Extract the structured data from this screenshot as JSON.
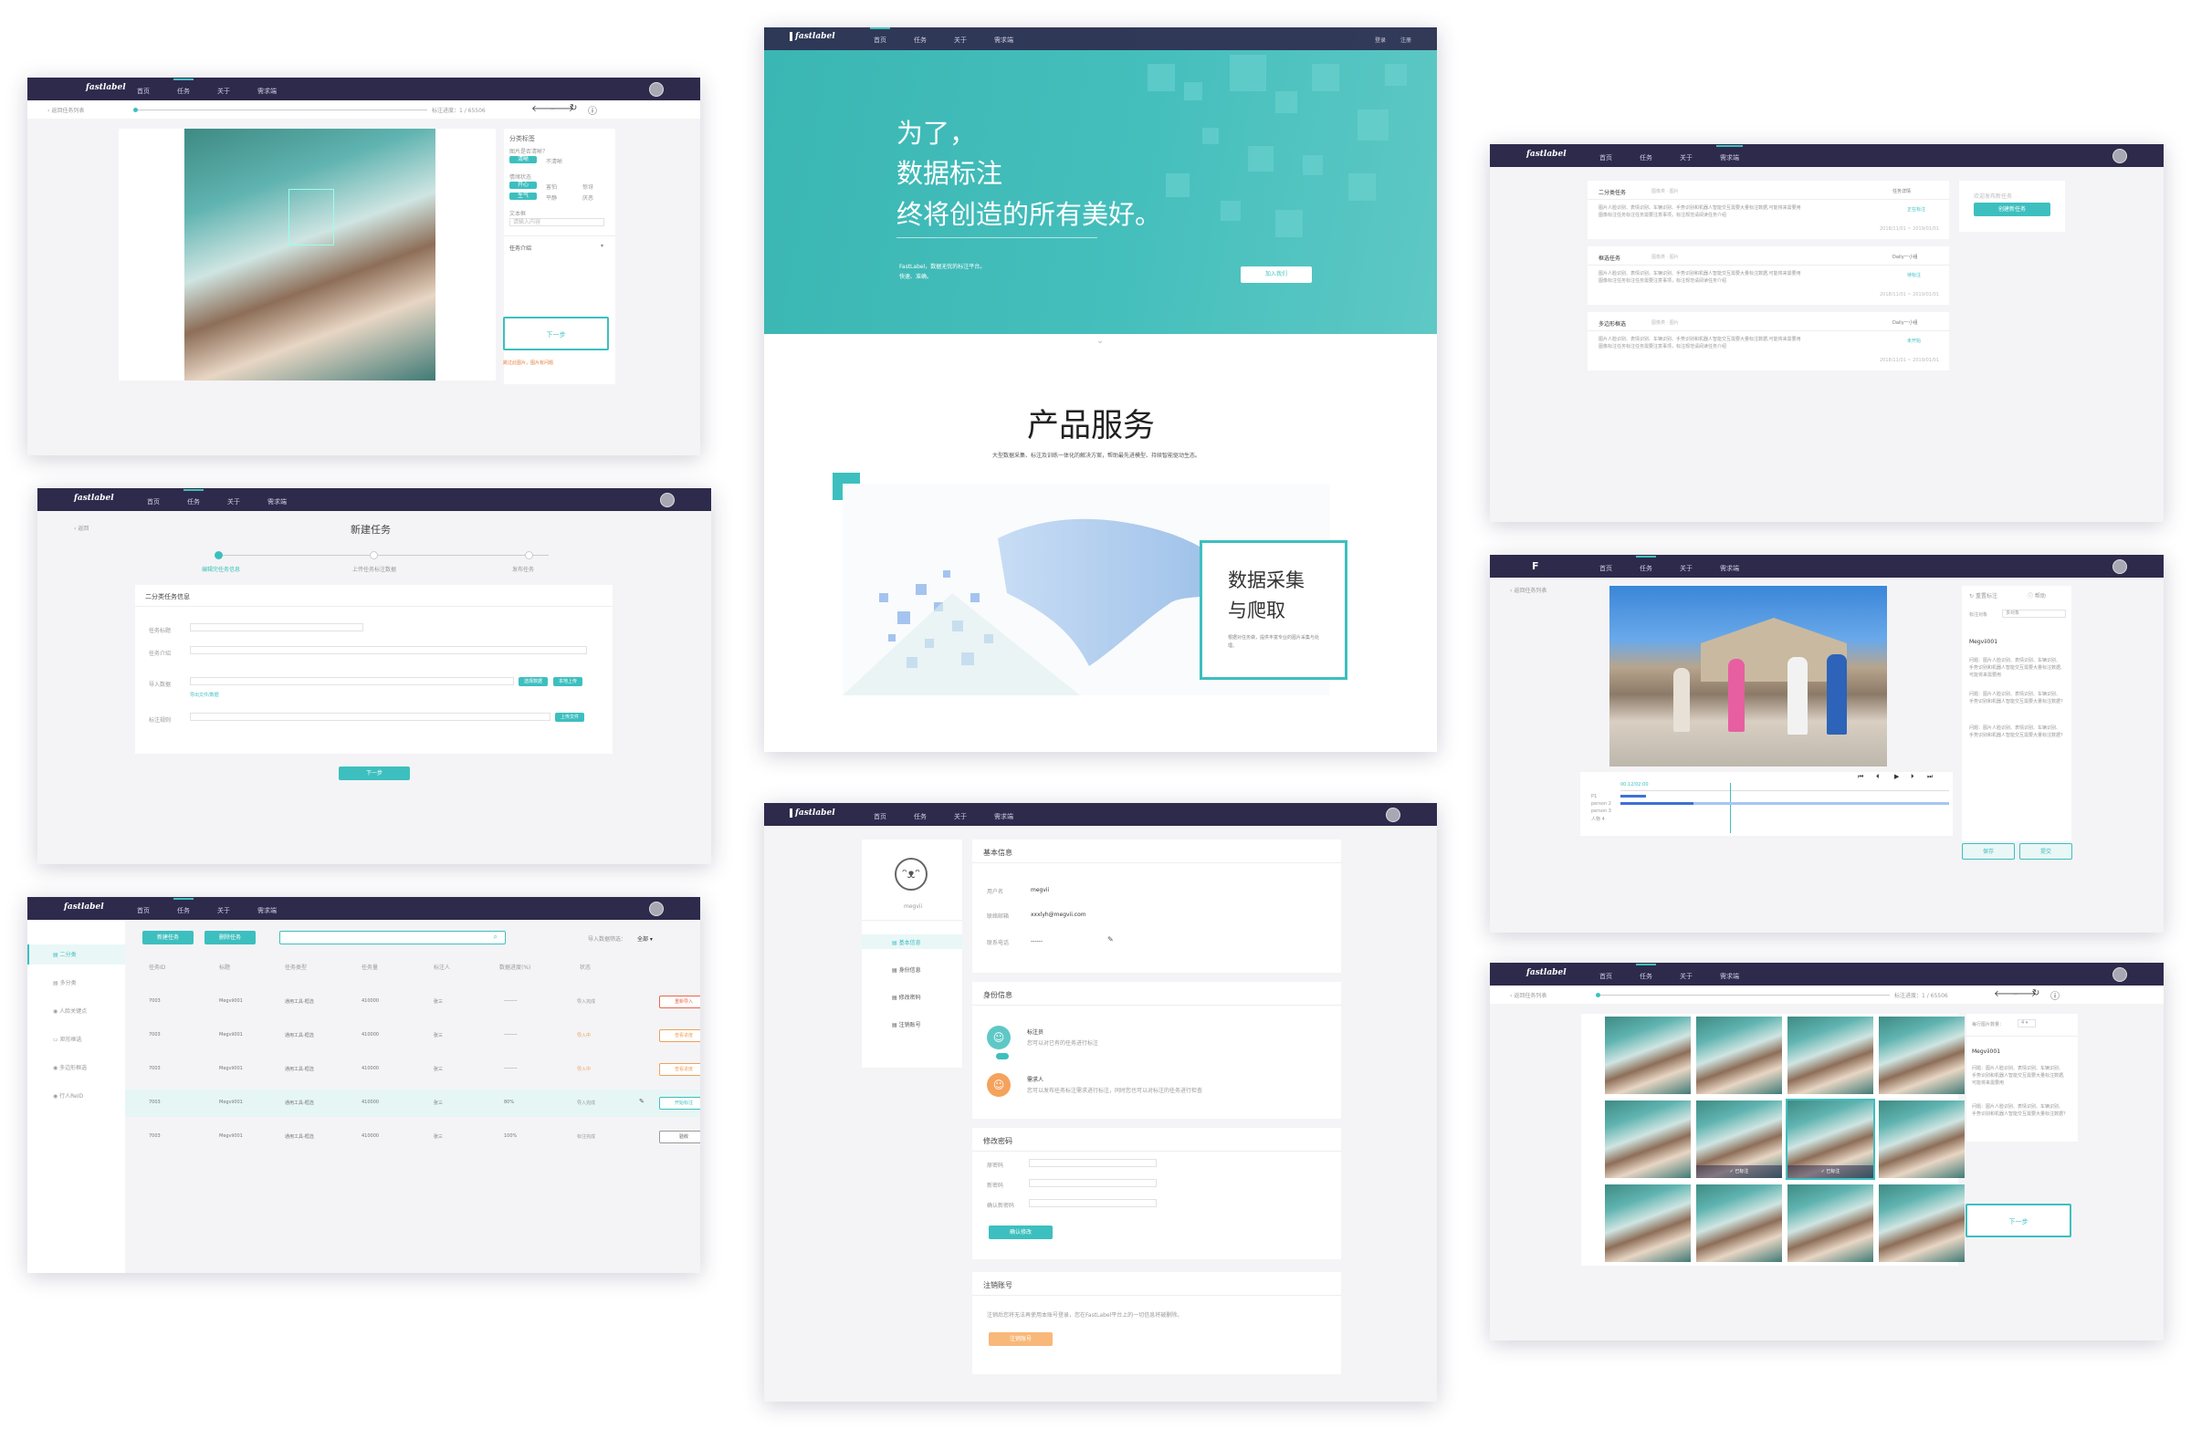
{
  "nav": {
    "home": "首页",
    "task": "任务",
    "about": "关于",
    "demand": "需求端"
  },
  "logo": "fastlabel",
  "brand": "fastlabel",
  "p1": {
    "back": "返回任务列表",
    "progress": "标注进度：1 / 65506",
    "section_title": "分类标签",
    "q1": "图片是否清晰？",
    "opt_clear": "清晰",
    "opt_unclear": "不清晰",
    "q2": "情绪状态",
    "opts": [
      "开心",
      "害怕",
      "惊讶",
      "生气",
      "平静",
      "厌恶"
    ],
    "text_label": "文本框",
    "text_placeholder": "请输入内容",
    "task_intro": "任务介绍",
    "next": "下一步",
    "skip": "跳过此图片，图片有问题"
  },
  "p2": {
    "back": "返回",
    "title": "新建任务",
    "steps": [
      "编辑完任务信息",
      "上传任务标注数据",
      "发布任务"
    ],
    "section": "二分类任务信息",
    "fields": [
      "任务标题",
      "任务介绍",
      "导入数据",
      "标注规则"
    ],
    "btn_upload_data": "选择数据",
    "btn_upload2": "本地上传",
    "link": "导出文件/数据",
    "btn_rule": "上传文件",
    "next": "下一步"
  },
  "p3": {
    "btn_new": "新建任务",
    "btn_filter": "删除任务",
    "filter_label": "导入数据筛选：",
    "filter_value": "全部",
    "sidebar": [
      "二分类",
      "多分类",
      "人脸关键点",
      "矩形框选",
      "多边形框选",
      "行人ReID"
    ],
    "headers": [
      "任务ID",
      "标题",
      "任务类型",
      "任务量",
      "标注人",
      "数据进度(%)",
      "状态"
    ],
    "rows": [
      {
        "id": "7003",
        "title": "Megvii001",
        "type": "通用工具-框选",
        "count": "410000",
        "labeler": "张三",
        "progress": "--------",
        "status": "导入完成",
        "action": "重新导入"
      },
      {
        "id": "7003",
        "title": "Megvii001",
        "type": "通用工具-框选",
        "count": "410000",
        "labeler": "张三",
        "progress": "--------",
        "status": "导入中",
        "action": "查看进度"
      },
      {
        "id": "7003",
        "title": "Megvii001",
        "type": "通用工具-框选",
        "count": "410000",
        "labeler": "张三",
        "progress": "--------",
        "status": "导入中",
        "action": "查看进度"
      },
      {
        "id": "7003",
        "title": "Megvii001",
        "type": "通用工具-框选",
        "count": "410000",
        "labeler": "张三",
        "progress": "80%",
        "status": "导入完成",
        "action": "开始标注"
      },
      {
        "id": "7003",
        "title": "Megvii001",
        "type": "通用工具-框选",
        "count": "410000",
        "labeler": "张三",
        "progress": "100%",
        "status": "标注完成",
        "action": "验收"
      }
    ]
  },
  "hero": {
    "line1": "为了，",
    "line2": "数据标注",
    "line3": "终将创造的所有美好。",
    "sub1": "FastLabel，数据无忧的标注平台。",
    "sub2": "快速、准确。",
    "cta": "加入我们",
    "login": "登录",
    "register": "注册"
  },
  "product": {
    "title": "产品服务",
    "desc": "大型数据采集、标注及训练一体化的解决方案，帮助最先进模型、持续智能驱动生态。",
    "box_title1": "数据采集",
    "box_title2": "与爬取",
    "box_desc": "根据对任务做，提供丰富专业的图片采集与处理。"
  },
  "p5": {
    "username": "megvii",
    "menu": [
      "基本信息",
      "身份信息",
      "修改密码",
      "注销账号"
    ],
    "basic": "基本信息",
    "basic_fields": [
      {
        "k": "用户名",
        "v": "megvii"
      },
      {
        "k": "联络邮箱",
        "v": "xxxlyh@megvii.com"
      },
      {
        "k": "联系电话",
        "v": "------"
      }
    ],
    "identity": "身份信息",
    "role1": "标注员",
    "role1_desc": "您可以对已有的任务进行标注",
    "role2": "需求人",
    "role2_desc": "您可以发布任务标注需求进行标注，同时您也可以对标注的任务进行检查",
    "pwd": "修改密码",
    "pwd_fields": [
      "原密码",
      "新密码",
      "确认新密码"
    ],
    "pwd_btn": "确认修改",
    "cancel": "注销账号",
    "cancel_desc": "注销后您将无法再使用本账号登录，您在FastLabel平台上的一切信息将被删除。",
    "cancel_btn": "注销账号"
  },
  "p6": {
    "cards": [
      {
        "title": "二分类任务",
        "tag": "图像类 · 图片",
        "more": "任务详情",
        "desc1": "图片人脸识别、表情识别、车辆识别、手势识别和机器人智能交互需要大量标注数据,可能将来需要用",
        "desc2": "图像标注任务标注任务需要注意事项，标注规范请阅读任务介绍",
        "state": "正在标注",
        "date": "2018/11/01 ~ 2019/01/01"
      },
      {
        "title": "框选任务",
        "tag": "图像类 · 图片",
        "more": "Daily一小组",
        "desc1": "图片人脸识别、表情识别、车辆识别、手势识别和机器人智能交互需要大量标注数据,可能将来需要用",
        "desc2": "图像标注任务标注任务需要注意事项，标注规范请阅读任务介绍",
        "state": "待标注",
        "date": "2018/11/01 ~ 2019/01/01"
      },
      {
        "title": "多边形框选",
        "tag": "图像类 · 图片",
        "more": "Daily一小组",
        "desc1": "图片人脸识别、表情识别、车辆识别、手势识别和机器人智能交互需要大量标注数据,可能将来需要用",
        "desc2": "图像标注任务标注任务需要注意事项，标注规范请阅读任务介绍",
        "state": "未开始",
        "date": "2018/11/01 ~ 2019/01/01"
      }
    ],
    "side_btn": "创建新任务",
    "side_hint": "欢迎发布新任务"
  },
  "p7": {
    "back": "返回任务列表",
    "tool1": "重置标注",
    "tool2": "帮助",
    "field": "标注对象",
    "field_val": "多对象",
    "task": "Megvii001",
    "q": [
      "问题：图片人脸识别、表情识别、车辆识别、手势识别和机器人智能交互需要大量标注数据,可能将来需要用",
      "问题：图片人脸识别、表情识别、车辆识别、手势识别和机器人智能交互需要大量标注数据?",
      "问题：图片人脸识别、表情识别、车辆识别、手势识别和机器人智能交互需要大量标注数据?"
    ],
    "tracks": [
      "P1",
      "person 2",
      "person 3",
      "人物 4"
    ],
    "time": "00:12/02:00",
    "save": "保存",
    "submit": "提交"
  },
  "p8": {
    "back": "返回任务列表",
    "progress": "标注进度：1 / 65506",
    "field": "每行图片数量：",
    "field_val": "4",
    "task": "Megvii001",
    "q1": "问题：图片人脸识别、表情识别、车辆识别、手势识别和机器人智能交互需要大量标注数据,可能将来需要用",
    "q2": "问题：图片人脸识别、表情识别、车辆识别、手势识别和机器人智能交互需要大量标注数据?",
    "badge": "已标注",
    "next": "下一步"
  }
}
